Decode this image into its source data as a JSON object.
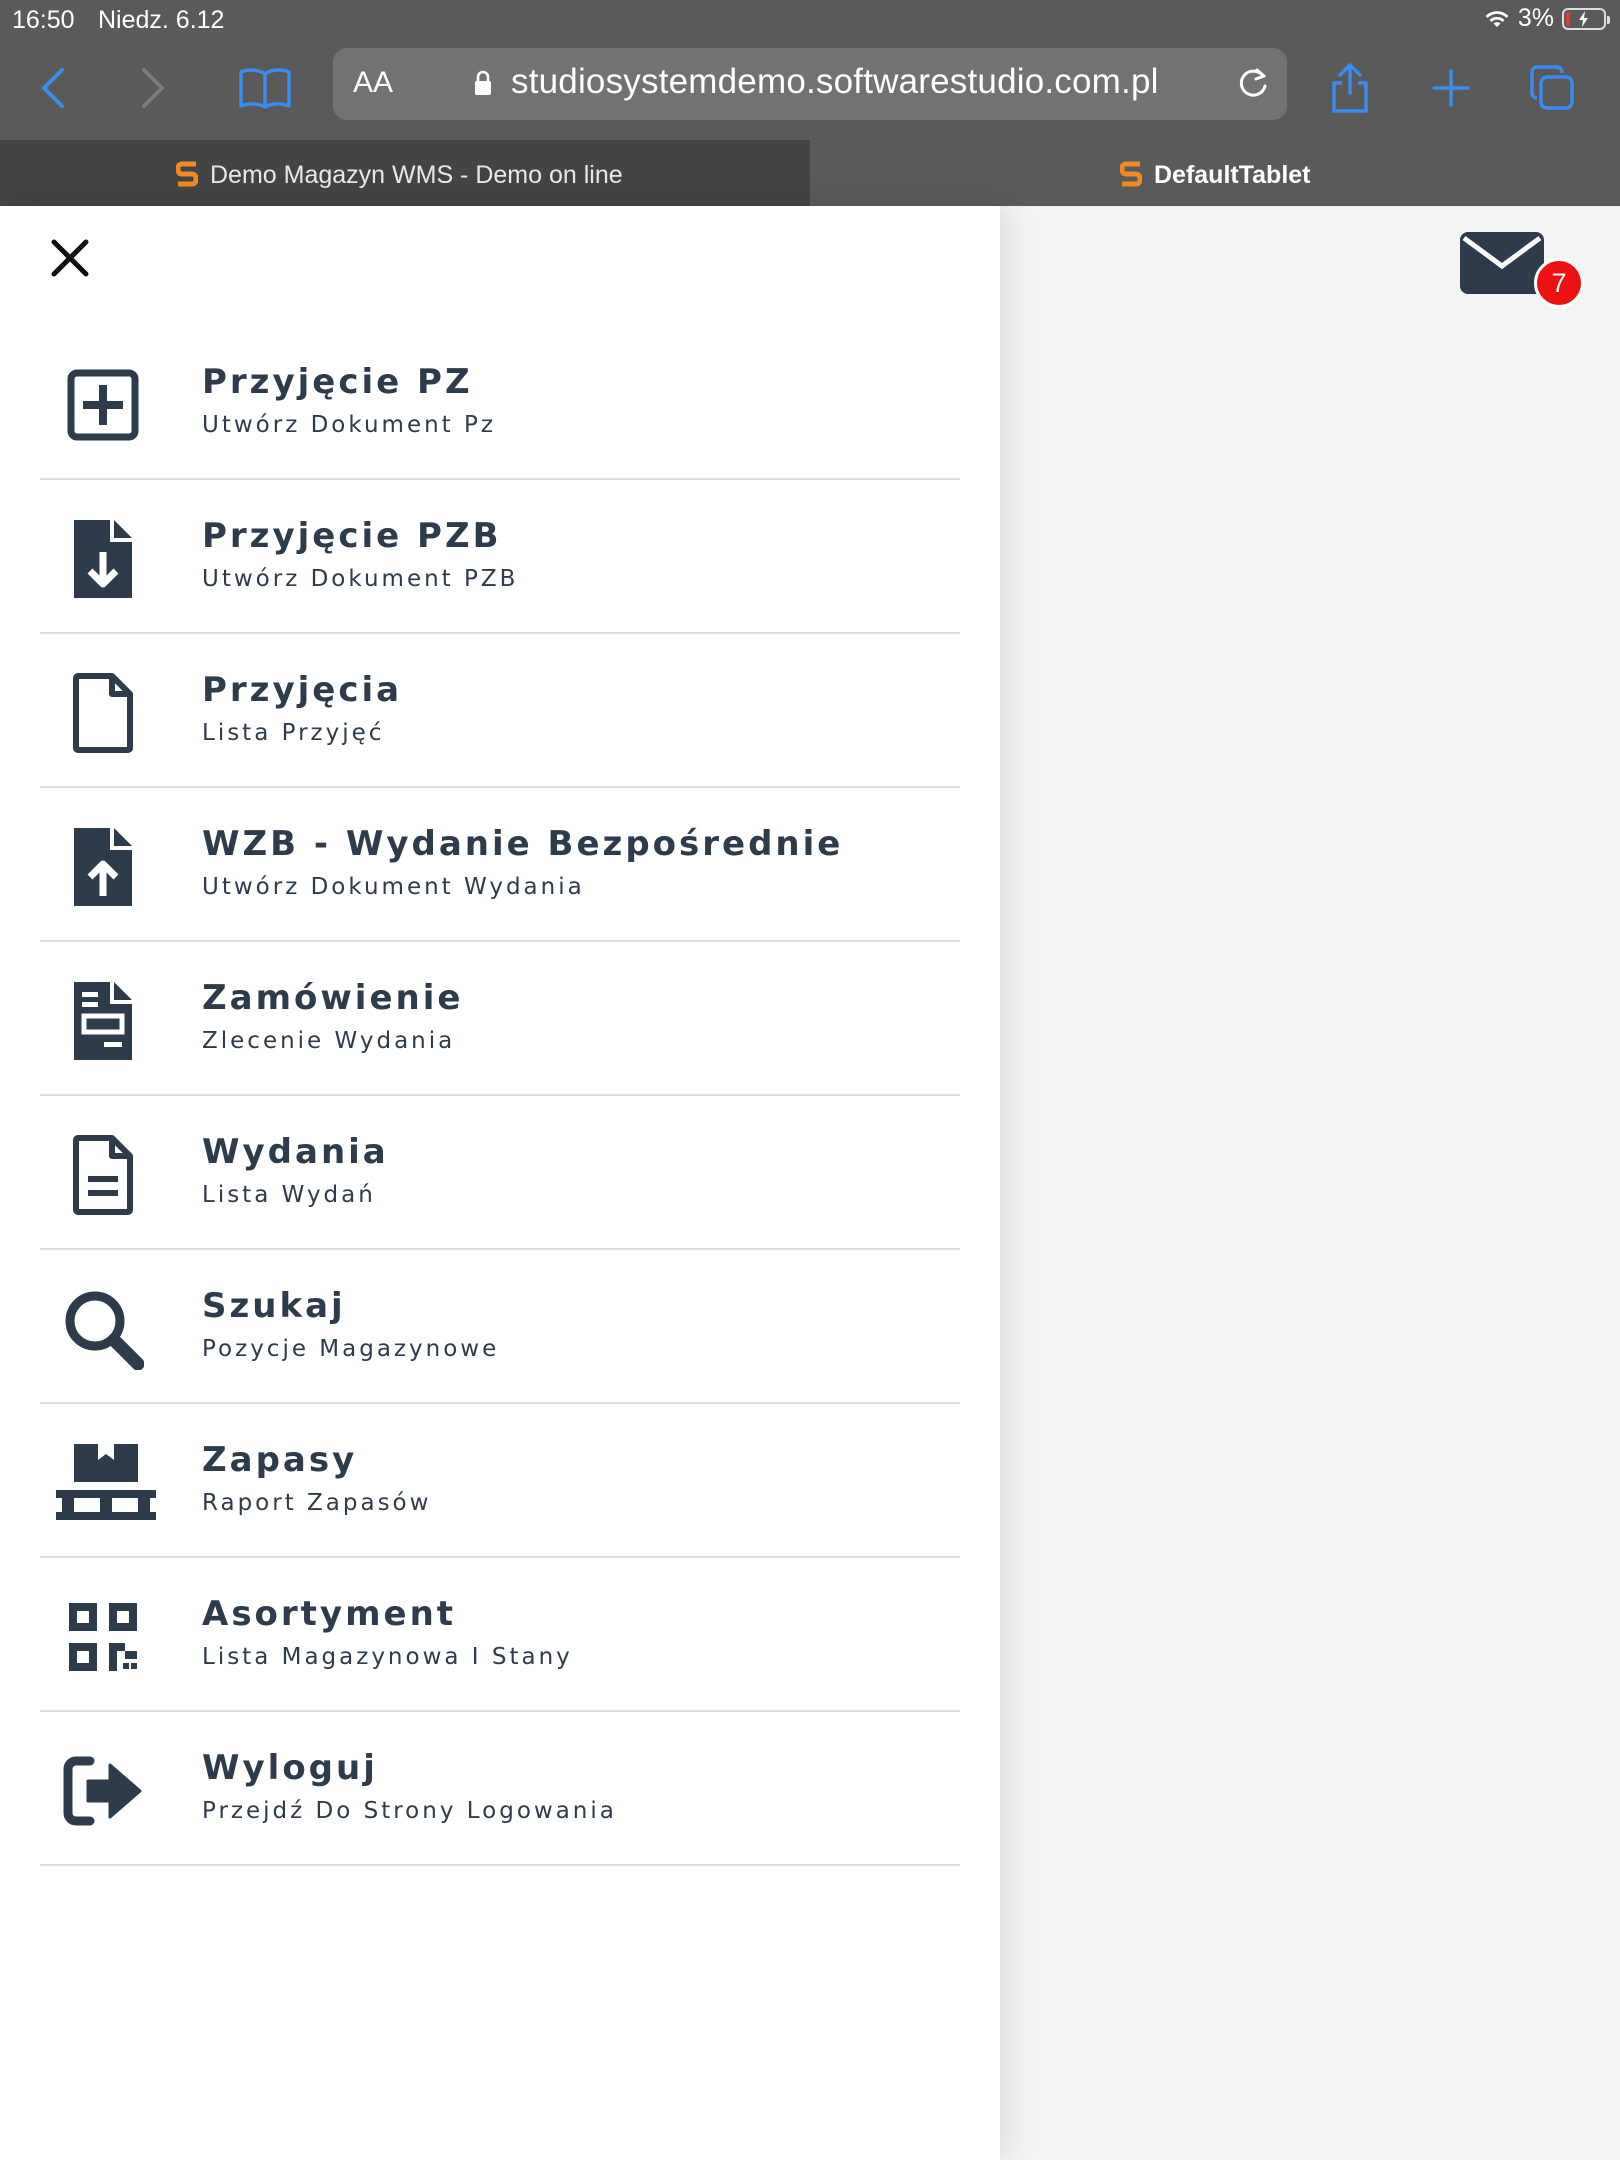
{
  "status": {
    "time": "16:50",
    "date": "Niedz. 6.12",
    "battery": "3%"
  },
  "browser": {
    "text_size": "AA",
    "url": "studiosystemdemo.softwarestudio.com.pl",
    "tabs": [
      {
        "label": "Demo Magazyn WMS - Demo on line"
      },
      {
        "label": "DefaultTablet"
      }
    ]
  },
  "notifications": {
    "count": "7"
  },
  "menu": [
    {
      "title": "Przyjęcie PZ",
      "subtitle": "Utwórz Dokument Pz",
      "icon": "plus-square-icon"
    },
    {
      "title": "Przyjęcie PZB",
      "subtitle": "Utwórz Dokument PZB",
      "icon": "file-download-icon"
    },
    {
      "title": "Przyjęcia",
      "subtitle": "Lista Przyjęć",
      "icon": "file-icon"
    },
    {
      "title": "WZB - Wydanie Bezpośrednie",
      "subtitle": "Utwórz Dokument Wydania",
      "icon": "file-upload-icon"
    },
    {
      "title": "Zamówienie",
      "subtitle": "Zlecenie Wydania",
      "icon": "file-invoice-icon"
    },
    {
      "title": "Wydania",
      "subtitle": "Lista Wydań",
      "icon": "file-alt-icon"
    },
    {
      "title": "Szukaj",
      "subtitle": "Pozycje Magazynowe",
      "icon": "search-icon"
    },
    {
      "title": "Zapasy",
      "subtitle": "Raport Zapasów",
      "icon": "pallet-icon"
    },
    {
      "title": "Asortyment",
      "subtitle": "Lista Magazynowa I Stany",
      "icon": "qrcode-icon"
    },
    {
      "title": "Wyloguj",
      "subtitle": "Przejdź Do Strony Logowania",
      "icon": "sign-out-icon"
    }
  ],
  "colors": {
    "menu_text": "#2d3b4a",
    "safari_blue": "#3b8cf0",
    "badge": "#ee1111",
    "brand": "#f08a24"
  }
}
